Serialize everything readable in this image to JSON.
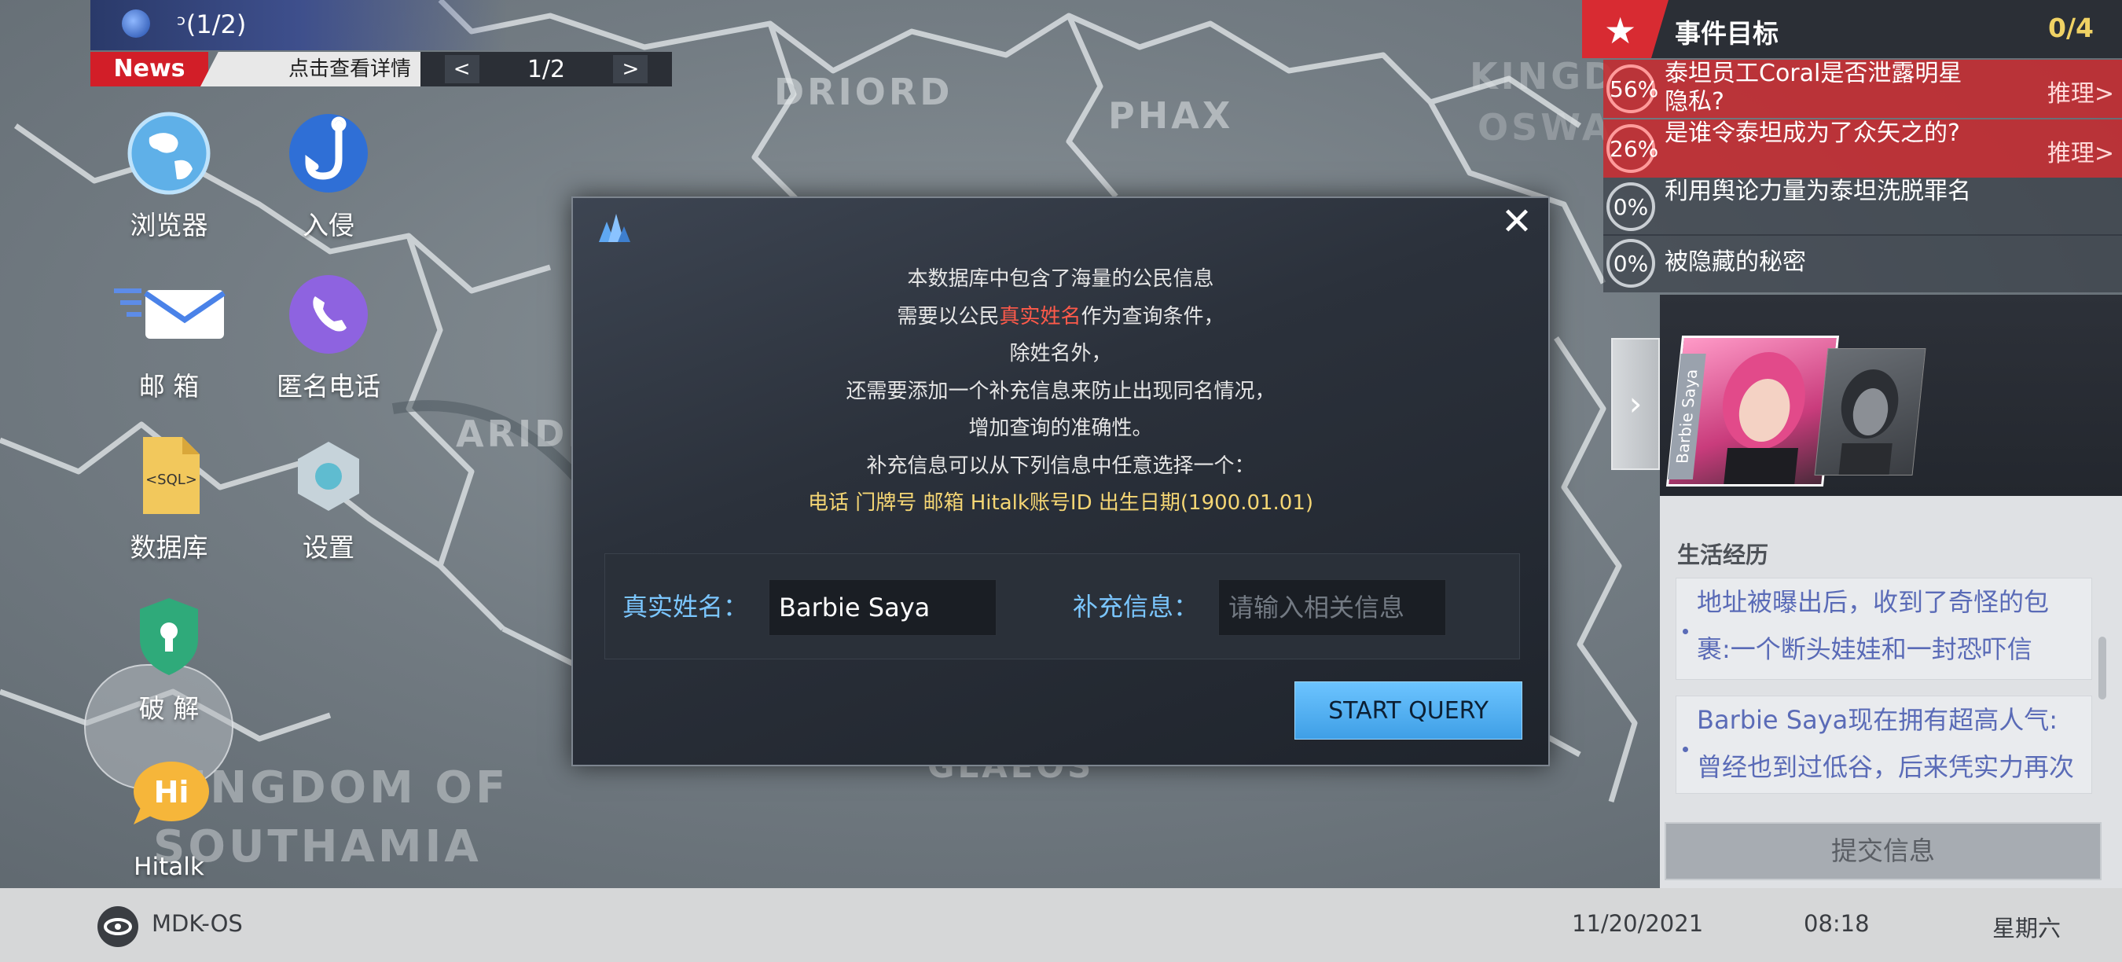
{
  "news": {
    "title": "ᵓ(1/2)",
    "badge": "News",
    "link": "点击查看详情",
    "page": "1/2",
    "prev_icon": "chevron-left-icon",
    "next_icon": "chevron-right-icon"
  },
  "map_labels": [
    "DRIORD",
    "PHAX",
    "KINGD",
    "OSWA",
    "ARIDR",
    "KINGDOM OF",
    "SOUTHAMIA",
    "GLAEOS"
  ],
  "desktop": [
    {
      "label": "浏览器",
      "icon": "globe-icon"
    },
    {
      "label": "入侵",
      "icon": "hook-icon"
    },
    {
      "label": "邮 箱",
      "icon": "mail-icon"
    },
    {
      "label": "匿名电话",
      "icon": "phone-icon"
    },
    {
      "label": "数据库",
      "icon": "sql-file-icon"
    },
    {
      "label": "设置",
      "icon": "hexagon-icon"
    },
    {
      "label": "破 解",
      "icon": "keyhole-shield-icon"
    },
    {
      "label": "Hitalk",
      "icon": "hi-bubble-icon"
    }
  ],
  "dialog": {
    "lines": [
      "本数据库中包含了海量的公民信息",
      "作为查询条件，",
      "除姓名外，",
      "还需要添加一个补充信息来防止出现同名情况，",
      "增加查询的准确性。",
      "补充信息可以从下列信息中任意选择一个："
    ],
    "line2_prefix": "需要以公民",
    "line2_highlight": "真实姓名",
    "options": "电话  门牌号  邮箱  Hitalk账号ID  出生日期(1900.01.01)",
    "name_label": "真实姓名：",
    "name_value": "Barbie Saya",
    "extra_label": "补充信息：",
    "extra_placeholder": "请输入相关信息",
    "query_button": "START QUERY",
    "accent": "#ff5a4a",
    "options_color": "#f5d674"
  },
  "objectives": {
    "title": "事件目标",
    "count": "0/4",
    "items": [
      {
        "percent": "56%",
        "text": "泰坦员工Coral是否泄露明星隐私?",
        "action": "推理>"
      },
      {
        "percent": "26%",
        "text": "是谁令泰坦成为了众矢之的?",
        "action": "推理>"
      },
      {
        "percent": "0%",
        "text": "利用舆论力量为泰坦洗脱罪名",
        "action": ""
      },
      {
        "percent": "0%",
        "text": "被隐藏的秘密",
        "action": ""
      }
    ]
  },
  "profile": {
    "card_name": "Barbie Saya",
    "section": "生活经历",
    "entries": [
      "地址被曝出后，收到了奇怪的包裹:一个断头娃娃和一封恐吓信",
      "Barbie Saya现在拥有超高人气:曾经也到过低谷，后来凭实力再次"
    ],
    "submit": "提交信息"
  },
  "taskbar": {
    "os": "MDK-OS",
    "date": "11/20/2021",
    "time": "08:18",
    "weekday": "星期六"
  }
}
